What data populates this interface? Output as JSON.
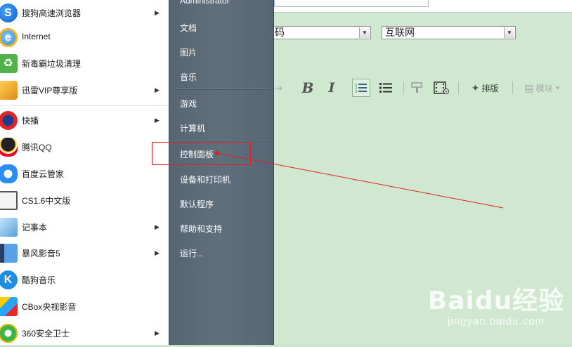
{
  "left_programs": [
    {
      "label": "搜狗高速浏览器",
      "icon": "sogou-browser-icon",
      "has_submenu": true
    },
    {
      "label": "Internet",
      "icon": "internet-explorer-icon",
      "has_submenu": false
    },
    {
      "label": "新毒霸垃圾清理",
      "icon": "recycle-icon",
      "has_submenu": false
    },
    {
      "label": "迅雷VIP尊享版",
      "icon": "xunlei-icon",
      "has_submenu": true
    },
    {
      "label": "快播",
      "icon": "qvod-icon",
      "has_submenu": true
    },
    {
      "label": "腾讯QQ",
      "icon": "qq-penguin-icon",
      "has_submenu": false
    },
    {
      "label": "百度云管家",
      "icon": "baidu-cloud-icon",
      "has_submenu": false
    },
    {
      "label": "CS1.6中文版",
      "icon": "counter-strike-icon",
      "has_submenu": false
    },
    {
      "label": "记事本",
      "icon": "notepad-icon",
      "has_submenu": true
    },
    {
      "label": "暴风影音5",
      "icon": "baofeng-icon",
      "has_submenu": true
    },
    {
      "label": "酷狗音乐",
      "icon": "kugou-icon",
      "has_submenu": false
    },
    {
      "label": "CBox央视影音",
      "icon": "cbox-icon",
      "has_submenu": false
    },
    {
      "label": "360安全卫士",
      "icon": "360-icon",
      "has_submenu": true
    }
  ],
  "right_places": [
    {
      "label": "Administrator"
    },
    {
      "label": "文档"
    },
    {
      "label": "图片"
    },
    {
      "label": "音乐"
    },
    {
      "label": "游戏"
    },
    {
      "label": "计算机"
    },
    {
      "label": "控制面板"
    },
    {
      "label": "设备和打印机"
    },
    {
      "label": "默认程序"
    },
    {
      "label": "帮助和支持"
    },
    {
      "label": "运行..."
    }
  ],
  "editor": {
    "select1_value": "码",
    "select2_value": "互联网",
    "toolbar": {
      "bold": "B",
      "italic": "I",
      "layout_label": "排版",
      "module_label": "模块"
    }
  },
  "watermark": {
    "brand": "Baidu经验",
    "url": "jingyan.baidu.com"
  },
  "colors": {
    "annotation": "#e02020",
    "editor_bg": "#cfe8cf",
    "start_menu_right": "#5f6f7c"
  }
}
